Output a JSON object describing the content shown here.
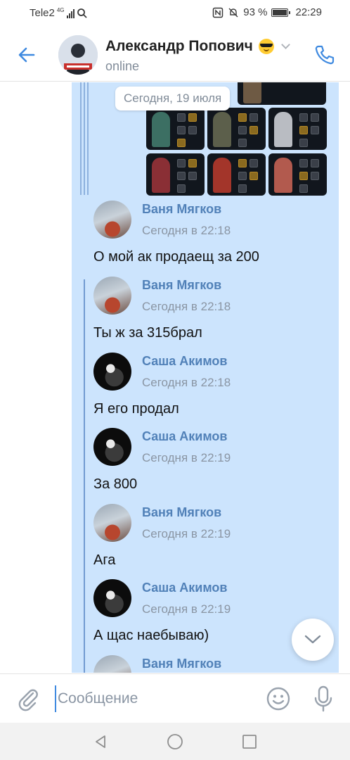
{
  "status_bar": {
    "carrier": "Tele2",
    "network_tag": "4G",
    "battery": "93 %",
    "time": "22:29"
  },
  "header": {
    "contact_name": "Александр Попович",
    "status": "online",
    "name_emoji": "smiling-face-with-sunglasses"
  },
  "date_separator": "Сегодня, 19 июля",
  "messages": [
    {
      "author": "Ваня Мягков",
      "time": "Сегодня в 22:18",
      "text": "О мой ак продаещ за 200"
    },
    {
      "author": "Ваня Мягков",
      "time": "Сегодня в 22:18",
      "text": "Ты ж за 315брал"
    },
    {
      "author": "Саша Акимов",
      "time": "Сегодня в 22:18",
      "text": "Я его продал"
    },
    {
      "author": "Саша Акимов",
      "time": "Сегодня в 22:19",
      "text": "За 800"
    },
    {
      "author": "Ваня Мягков",
      "time": "Сегодня в 22:19",
      "text": "Ага"
    },
    {
      "author": "Саша Акимов",
      "time": "Сегодня в 22:19",
      "text": "А щас наебываю)"
    },
    {
      "author": "Ваня Мягков"
    }
  ],
  "composer": {
    "placeholder": "Сообщение"
  },
  "colors": {
    "accent": "#3f8ae0",
    "author": "#5181b8",
    "selected_bg": "#cce4fd"
  }
}
